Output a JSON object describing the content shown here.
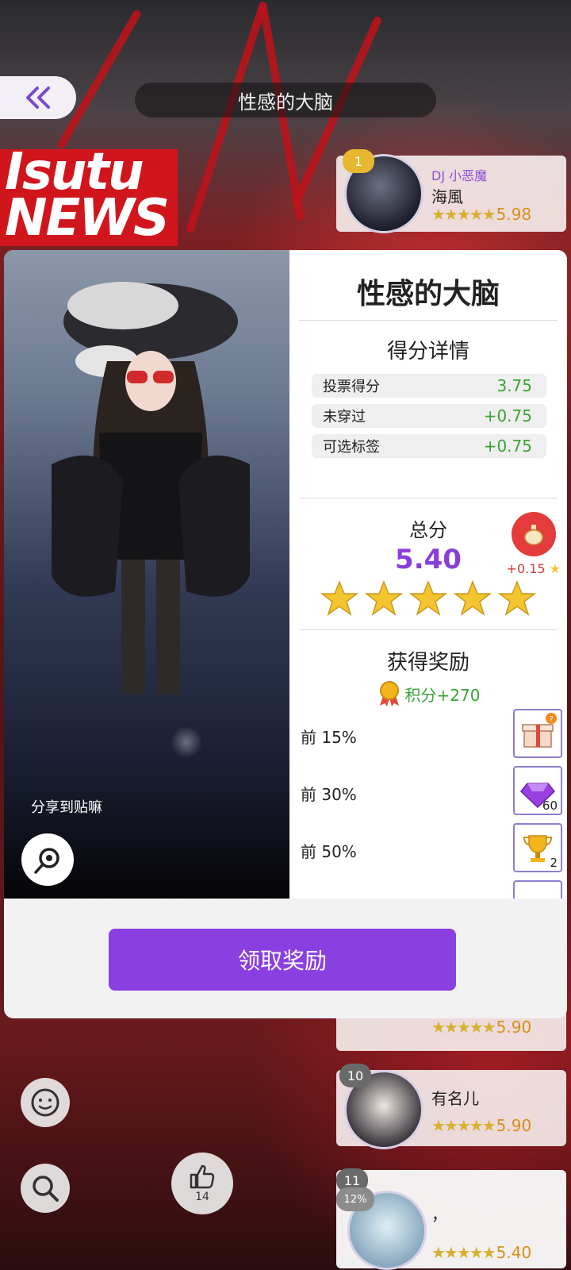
{
  "header": {
    "back_icon": "double-chevron-left-icon",
    "title": "性感的大脑",
    "news_banner": "Isutu NEWS"
  },
  "leaderboard": [
    {
      "rank": "1",
      "tag": "DJ 小恶魔",
      "name": "海風",
      "stars": "★★★★★",
      "score": "5.98"
    },
    {
      "rank": "",
      "name": "",
      "stars": "★★★★★",
      "score": "5.90"
    },
    {
      "rank": "10",
      "name": "有名儿",
      "stars": "★★★★★",
      "score": "5.90"
    },
    {
      "rank": "11",
      "name": "，",
      "stars": "★★★★★",
      "score": "5.40",
      "progress_badge": "12%"
    }
  ],
  "bottom_controls": {
    "emoji_icon": "smiley-icon",
    "search_icon": "magnifier-icon",
    "like_icon": "thumbs-up-icon",
    "like_count": "14"
  },
  "modal": {
    "title": "性感的大脑",
    "share_label": "分享到贴嘛",
    "score_details": {
      "title": "得分详情",
      "rows": [
        {
          "label": "投票得分",
          "value": "3.75"
        },
        {
          "label": "未穿过",
          "value": "+0.75"
        },
        {
          "label": "可选标签",
          "value": "+0.75"
        }
      ]
    },
    "total": {
      "label": "总分",
      "value": "5.40",
      "stars": 5,
      "bonus": "+0.15"
    },
    "rewards": {
      "title": "获得奖励",
      "points": "积分+270",
      "tiers": [
        {
          "label": "前 15%",
          "item": "gift-box-icon",
          "qty": ""
        },
        {
          "label": "前 30%",
          "item": "purple-gem-icon",
          "qty": "60"
        },
        {
          "label": "前 50%",
          "item": "gold-trophy-icon",
          "qty": "2"
        }
      ]
    },
    "claim_button": "领取奖励"
  },
  "colors": {
    "accent": "#8a3fe0",
    "score_green": "#3aa433",
    "total_purple": "#8a3fd6",
    "star_gold": "#f4c531",
    "bonus_red": "#e43c3c"
  }
}
